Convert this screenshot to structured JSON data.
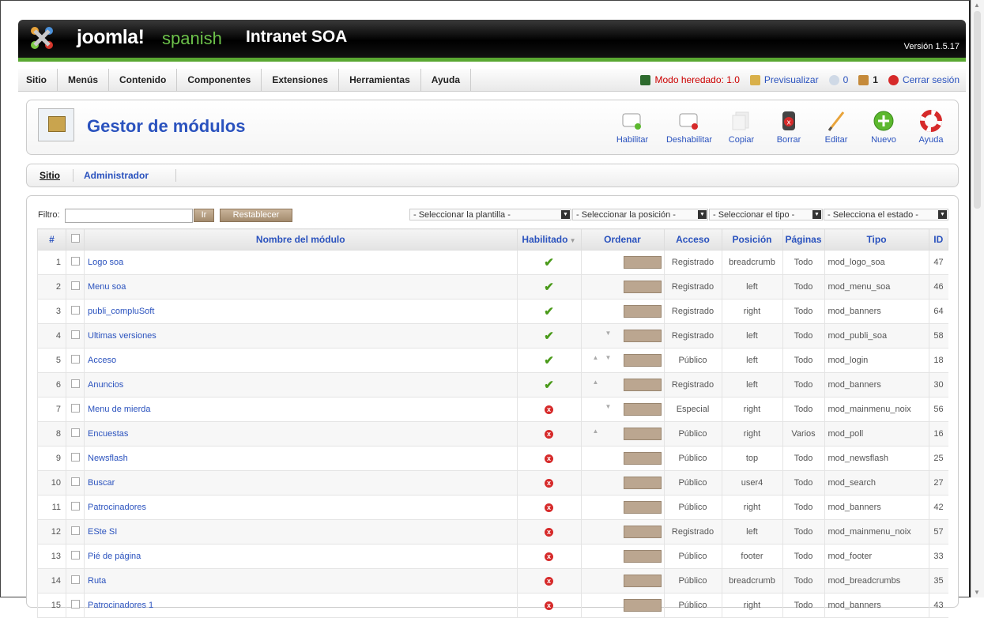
{
  "header": {
    "brand": "joomla!",
    "brand_sub": "spanish",
    "site_name": "Intranet SOA",
    "version": "Versión 1.5.17"
  },
  "menu": [
    "Sitio",
    "Menús",
    "Contenido",
    "Componentes",
    "Extensiones",
    "Herramientas",
    "Ayuda"
  ],
  "status": {
    "legacy": "Modo heredado: 1.0",
    "preview": "Previsualizar",
    "messages": "0",
    "users": "1",
    "logout": "Cerrar sesión"
  },
  "page": {
    "title": "Gestor de módulos"
  },
  "toolbar": {
    "enable": "Habilitar",
    "disable": "Deshabilitar",
    "copy": "Copiar",
    "delete": "Borrar",
    "edit": "Editar",
    "new": "Nuevo",
    "help": "Ayuda"
  },
  "subnav": {
    "site": "Sitio",
    "admin": "Administrador"
  },
  "filter": {
    "label": "Filtro:",
    "value": "",
    "go": "Ir",
    "reset": "Restablecer",
    "template": "- Seleccionar la plantilla -",
    "position": "- Seleccionar la posición -",
    "type": "- Seleccionar el tipo -",
    "state": "- Selecciona el estado -"
  },
  "table": {
    "headers": {
      "num": "#",
      "name": "Nombre del módulo",
      "enabled": "Habilitado",
      "order": "Ordenar",
      "access": "Acceso",
      "position": "Posición",
      "pages": "Páginas",
      "type": "Tipo",
      "id": "ID"
    },
    "rows": [
      {
        "n": "1",
        "name": "Logo soa",
        "enabled": true,
        "up": false,
        "down": false,
        "access": "Registrado",
        "acc": "reg",
        "pos": "breadcrumb",
        "pages": "Todo",
        "type": "mod_logo_soa",
        "id": "47"
      },
      {
        "n": "2",
        "name": "Menu soa",
        "enabled": true,
        "up": false,
        "down": false,
        "access": "Registrado",
        "acc": "reg",
        "pos": "left",
        "pages": "Todo",
        "type": "mod_menu_soa",
        "id": "46"
      },
      {
        "n": "3",
        "name": "publi_compluSoft",
        "enabled": true,
        "up": false,
        "down": false,
        "access": "Registrado",
        "acc": "reg",
        "pos": "right",
        "pages": "Todo",
        "type": "mod_banners",
        "id": "64"
      },
      {
        "n": "4",
        "name": "Ultimas versiones",
        "enabled": true,
        "up": false,
        "down": true,
        "access": "Registrado",
        "acc": "reg",
        "pos": "left",
        "pages": "Todo",
        "type": "mod_publi_soa",
        "id": "58"
      },
      {
        "n": "5",
        "name": "Acceso",
        "enabled": true,
        "up": true,
        "down": true,
        "access": "Público",
        "acc": "pub",
        "pos": "left",
        "pages": "Todo",
        "type": "mod_login",
        "id": "18"
      },
      {
        "n": "6",
        "name": "Anuncios",
        "enabled": true,
        "up": true,
        "down": false,
        "access": "Registrado",
        "acc": "reg",
        "pos": "left",
        "pages": "Todo",
        "type": "mod_banners",
        "id": "30"
      },
      {
        "n": "7",
        "name": "Menu de mierda",
        "enabled": false,
        "up": false,
        "down": true,
        "access": "Especial",
        "acc": "esp",
        "pos": "right",
        "pages": "Todo",
        "type": "mod_mainmenu_noix",
        "id": "56"
      },
      {
        "n": "8",
        "name": "Encuestas",
        "enabled": false,
        "up": true,
        "down": false,
        "access": "Público",
        "acc": "pub",
        "pos": "right",
        "pages": "Varios",
        "type": "mod_poll",
        "id": "16"
      },
      {
        "n": "9",
        "name": "Newsflash",
        "enabled": false,
        "up": false,
        "down": false,
        "access": "Público",
        "acc": "pub",
        "pos": "top",
        "pages": "Todo",
        "type": "mod_newsflash",
        "id": "25"
      },
      {
        "n": "10",
        "name": "Buscar",
        "enabled": false,
        "up": false,
        "down": false,
        "access": "Público",
        "acc": "pub",
        "pos": "user4",
        "pages": "Todo",
        "type": "mod_search",
        "id": "27"
      },
      {
        "n": "11",
        "name": "Patrocinadores",
        "enabled": false,
        "up": false,
        "down": false,
        "access": "Público",
        "acc": "pub",
        "pos": "right",
        "pages": "Todo",
        "type": "mod_banners",
        "id": "42"
      },
      {
        "n": "12",
        "name": "ESte SI",
        "enabled": false,
        "up": false,
        "down": false,
        "access": "Registrado",
        "acc": "reg",
        "pos": "left",
        "pages": "Todo",
        "type": "mod_mainmenu_noix",
        "id": "57"
      },
      {
        "n": "13",
        "name": "Pié de página",
        "enabled": false,
        "up": false,
        "down": false,
        "access": "Público",
        "acc": "pub",
        "pos": "footer",
        "pages": "Todo",
        "type": "mod_footer",
        "id": "33"
      },
      {
        "n": "14",
        "name": "Ruta",
        "enabled": false,
        "up": false,
        "down": false,
        "access": "Público",
        "acc": "pub",
        "pos": "breadcrumb",
        "pages": "Todo",
        "type": "mod_breadcrumbs",
        "id": "35"
      },
      {
        "n": "15",
        "name": "Patrocinadores 1",
        "enabled": false,
        "up": false,
        "down": false,
        "access": "Público",
        "acc": "pub",
        "pos": "right",
        "pages": "Todo",
        "type": "mod_banners",
        "id": "43"
      }
    ]
  }
}
